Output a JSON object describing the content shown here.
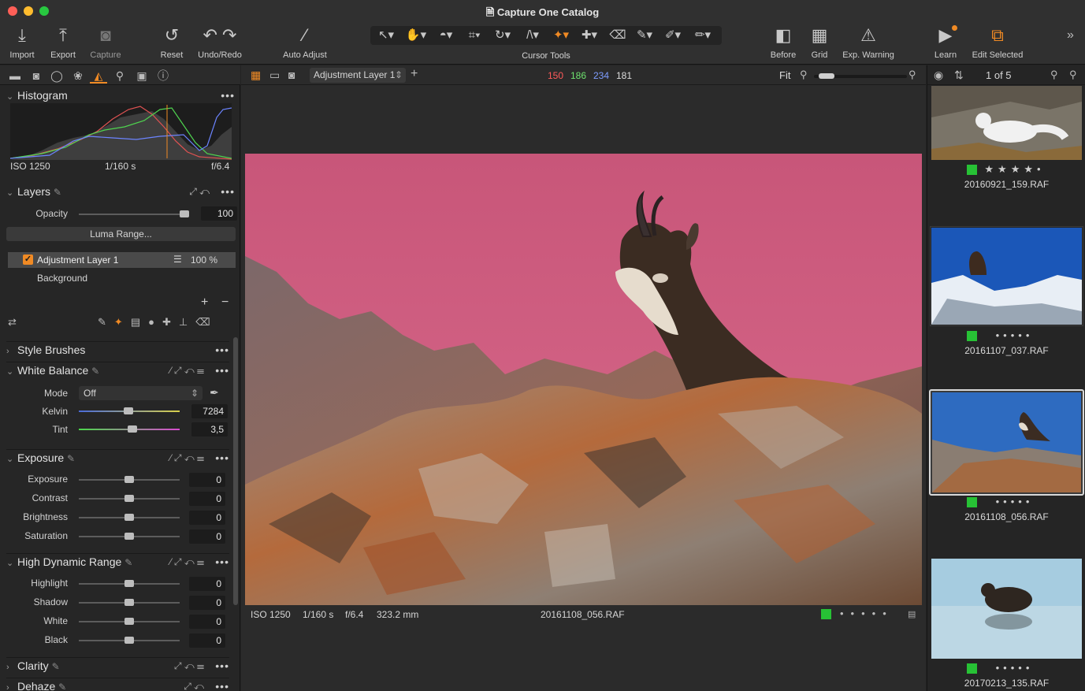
{
  "window": {
    "title": "Capture One Catalog"
  },
  "toolbar": {
    "items": [
      {
        "label": "Import",
        "icon": "import-icon"
      },
      {
        "label": "Export",
        "icon": "export-icon"
      },
      {
        "label": "Capture",
        "icon": "camera-icon"
      },
      {
        "label": "Reset",
        "icon": "reset-icon"
      },
      {
        "label": "Undo/Redo",
        "icon": "undo-redo-icon"
      },
      {
        "label": "Auto Adjust",
        "icon": "magic-wand-icon"
      }
    ],
    "cursor_tools_label": "Cursor Tools",
    "right_items": [
      {
        "label": "Before",
        "icon": "before-icon"
      },
      {
        "label": "Grid",
        "icon": "grid-icon"
      },
      {
        "label": "Exp. Warning",
        "icon": "warning-icon"
      },
      {
        "label": "Learn",
        "icon": "learn-icon"
      },
      {
        "label": "Edit Selected",
        "icon": "edit-selected-icon"
      }
    ]
  },
  "histogram": {
    "title": "Histogram",
    "iso": "ISO 1250",
    "shutter": "1/160 s",
    "aperture": "f/6.4"
  },
  "layers": {
    "title": "Layers",
    "opacity_label": "Opacity",
    "opacity_value": "100",
    "luma_button": "Luma Range...",
    "items": [
      {
        "name": "Adjustment Layer 1",
        "value": "100 %",
        "checked": true
      },
      {
        "name": "Background"
      }
    ]
  },
  "style_brushes": {
    "title": "Style Brushes"
  },
  "white_balance": {
    "title": "White Balance",
    "mode_label": "Mode",
    "mode_value": "Off",
    "kelvin_label": "Kelvin",
    "kelvin_value": "7284",
    "kelvin_pos": 0.49,
    "tint_label": "Tint",
    "tint_value": "3,5",
    "tint_pos": 0.53
  },
  "exposure": {
    "title": "Exposure",
    "rows": [
      {
        "label": "Exposure",
        "value": "0",
        "pos": 0.5
      },
      {
        "label": "Contrast",
        "value": "0",
        "pos": 0.5
      },
      {
        "label": "Brightness",
        "value": "0",
        "pos": 0.5
      },
      {
        "label": "Saturation",
        "value": "0",
        "pos": 0.5
      }
    ]
  },
  "hdr": {
    "title": "High Dynamic Range",
    "rows": [
      {
        "label": "Highlight",
        "value": "0",
        "pos": 0.5
      },
      {
        "label": "Shadow",
        "value": "0",
        "pos": 0.5
      },
      {
        "label": "White",
        "value": "0",
        "pos": 0.5
      },
      {
        "label": "Black",
        "value": "0",
        "pos": 0.5
      }
    ]
  },
  "clarity": {
    "title": "Clarity"
  },
  "dehaze": {
    "title": "Dehaze"
  },
  "viewer": {
    "layer_select": "Adjustment Layer 1",
    "rgb": {
      "r": "150",
      "g": "186",
      "b": "234",
      "l": "181"
    },
    "zoom_label": "Fit",
    "zoom_level": 0.05,
    "info": {
      "iso": "ISO 1250",
      "shutter": "1/160 s",
      "aperture": "f/6.4",
      "focal": "323.2 mm",
      "filename": "20161108_056.RAF"
    }
  },
  "browser": {
    "count": "1 of 5",
    "thumbs": [
      {
        "name": "20160921_159.RAF",
        "stars": "★★★★•"
      },
      {
        "name": "20161107_037.RAF",
        "stars": "•••••"
      },
      {
        "name": "20161108_056.RAF",
        "stars": "•••••"
      },
      {
        "name": "20170213_135.RAF",
        "stars": "•••••"
      }
    ]
  },
  "colors": {
    "accent": "#f08a24",
    "green_label": "#27c235",
    "red": "#ff5a5a",
    "green": "#6fe36f",
    "blue": "#7e9dff",
    "sky": "#c85a7e"
  }
}
